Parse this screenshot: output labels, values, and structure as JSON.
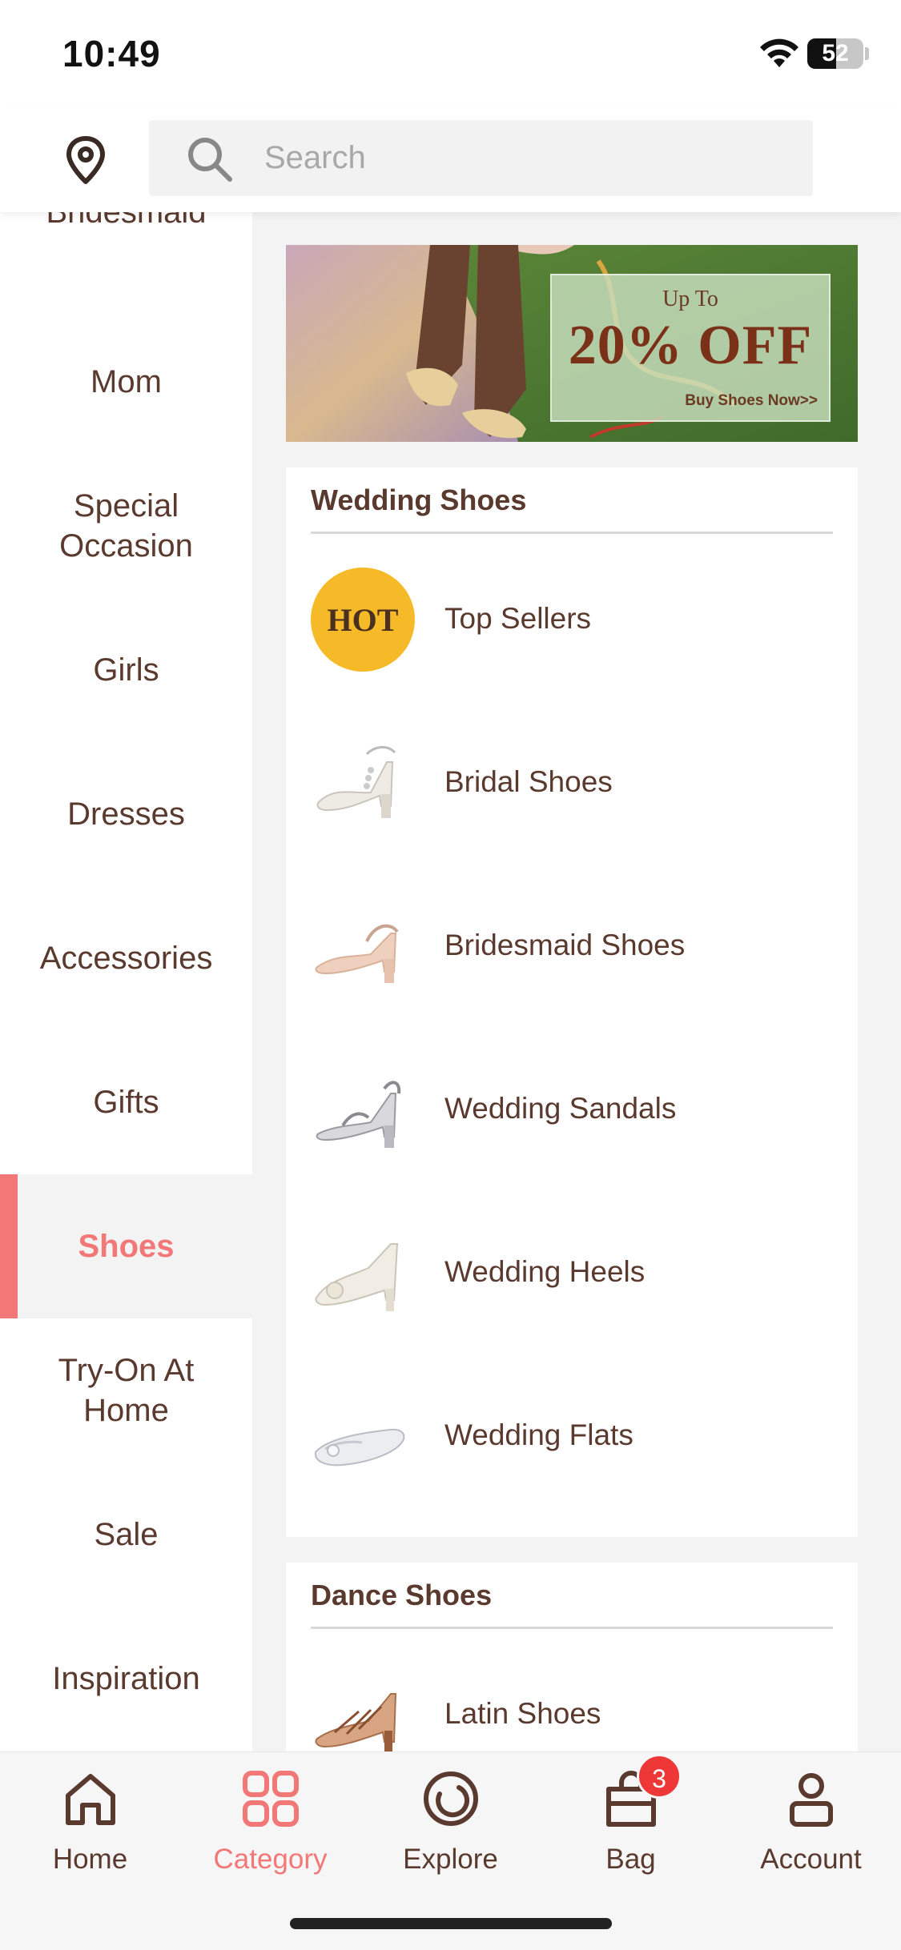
{
  "status_bar": {
    "time": "10:49",
    "battery": "52",
    "battery_level": 0.52
  },
  "search": {
    "placeholder": "Search"
  },
  "sidebar": {
    "items": [
      {
        "label": "Bridesmaid",
        "active": false
      },
      {
        "label": "Mom",
        "active": false
      },
      {
        "label": "Special Occasion",
        "active": false
      },
      {
        "label": "Girls",
        "active": false
      },
      {
        "label": "Dresses",
        "active": false
      },
      {
        "label": "Accessories",
        "active": false
      },
      {
        "label": "Gifts",
        "active": false
      },
      {
        "label": "Shoes",
        "active": true
      },
      {
        "label": "Try-On At Home",
        "active": false
      },
      {
        "label": "Sale",
        "active": false
      },
      {
        "label": "Inspiration",
        "active": false
      }
    ]
  },
  "banner": {
    "up_to": "Up To",
    "offer": "20% OFF",
    "cta": "Buy Shoes Now>>"
  },
  "sections": [
    {
      "title": "Wedding Shoes",
      "items": [
        {
          "label": "Top Sellers",
          "badge": "HOT",
          "icon": "hot-badge"
        },
        {
          "label": "Bridal Shoes",
          "icon": "bridal-shoe-icon"
        },
        {
          "label": "Bridesmaid Shoes",
          "icon": "bridesmaid-shoe-icon"
        },
        {
          "label": "Wedding Sandals",
          "icon": "sandal-icon"
        },
        {
          "label": "Wedding Heels",
          "icon": "heel-icon"
        },
        {
          "label": "Wedding Flats",
          "icon": "flat-shoe-icon"
        }
      ]
    },
    {
      "title": "Dance Shoes",
      "items": [
        {
          "label": "Latin Shoes",
          "icon": "latin-shoe-icon"
        }
      ]
    }
  ],
  "tabbar": {
    "tabs": [
      {
        "label": "Home",
        "icon": "home-icon",
        "active": false
      },
      {
        "label": "Category",
        "icon": "category-grid-icon",
        "active": true
      },
      {
        "label": "Explore",
        "icon": "explore-icon",
        "active": false
      },
      {
        "label": "Bag",
        "icon": "bag-icon",
        "active": false,
        "badge": "3"
      },
      {
        "label": "Account",
        "icon": "account-icon",
        "active": false
      }
    ]
  },
  "colors": {
    "accent": "#f27878",
    "text": "#5a3a2e",
    "hot": "#f6b928",
    "badge": "#ee3838"
  }
}
